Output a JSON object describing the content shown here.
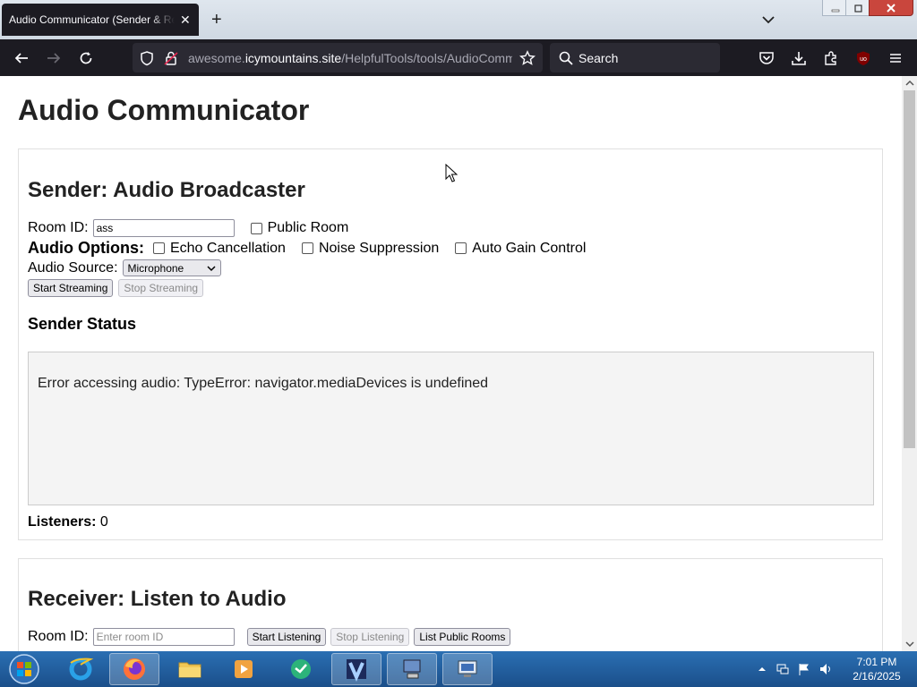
{
  "browser": {
    "tab_title": "Audio Communicator (Sender & Receiver)",
    "tab_close": "✕",
    "new_tab": "+",
    "url_prefix": "awesome.",
    "url_domain": "icymountains.site",
    "url_path": "/HelpfulTools/tools/AudioCommunicator",
    "search_placeholder": "Search",
    "extension_badge": "uo"
  },
  "page": {
    "title": "Audio Communicator",
    "sender": {
      "heading": "Sender: Audio Broadcaster",
      "room_id_label": "Room ID:",
      "room_id_value": "ass",
      "public_room_label": "Public Room",
      "audio_options_label": "Audio Options:",
      "echo_label": "Echo Cancellation",
      "noise_label": "Noise Suppression",
      "gain_label": "Auto Gain Control",
      "audio_source_label": "Audio Source:",
      "audio_source_value": "Microphone",
      "start_button": "Start Streaming",
      "stop_button": "Stop Streaming",
      "status_heading": "Sender Status",
      "status_message": "Error accessing audio: TypeError: navigator.mediaDevices is undefined",
      "listeners_label": "Listeners:",
      "listeners_count": "0"
    },
    "receiver": {
      "heading": "Receiver: Listen to Audio",
      "room_id_label": "Room ID:",
      "room_id_placeholder": "Enter room ID",
      "start_button": "Start Listening",
      "stop_button": "Stop Listening",
      "list_button": "List Public Rooms"
    }
  },
  "taskbar": {
    "time": "7:01 PM",
    "date": "2/16/2025"
  },
  "colors": {
    "browser_dark": "#1c1b22",
    "urlbar": "#2b2a33",
    "taskbar": "#1f5c9e"
  }
}
